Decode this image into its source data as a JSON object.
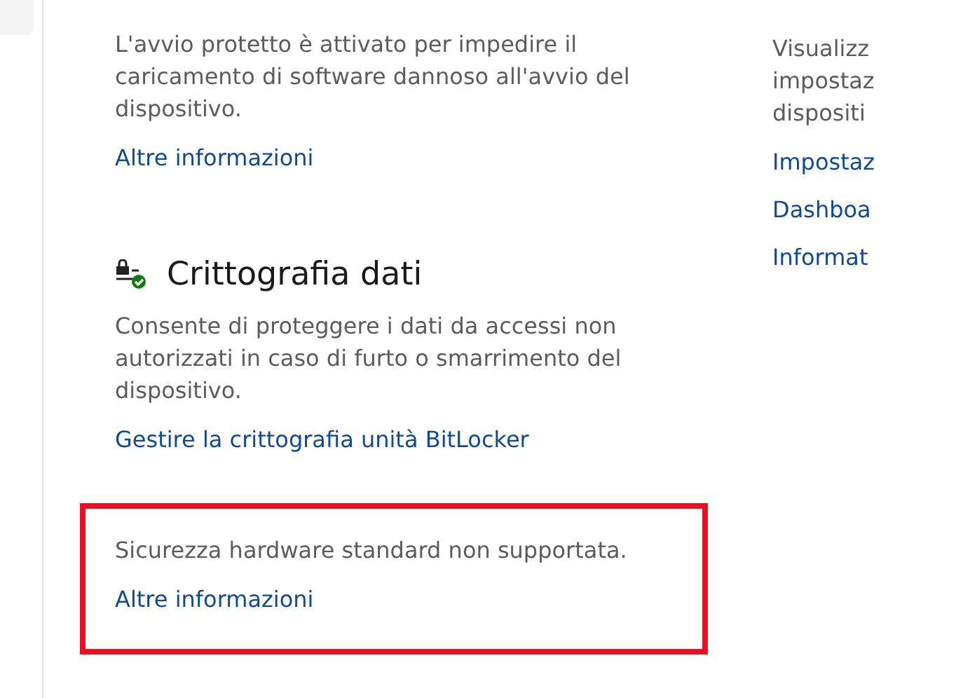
{
  "sections": [
    {
      "kind": "plain",
      "description": "L'avvio protetto è attivato per impedire il caricamento di software dannoso all'avvio del dispositivo.",
      "links": [
        "Altre informazioni"
      ]
    },
    {
      "kind": "titled",
      "title": "Crittografia dati",
      "description": "Consente di proteggere i dati da accessi non autorizzati in caso di furto o smarrimento del dispositivo.",
      "links": [
        "Gestire la crittografia unità BitLocker"
      ]
    },
    {
      "kind": "highlighted",
      "description": "Sicurezza hardware standard non supportata.",
      "links": [
        "Altre informazioni"
      ]
    }
  ],
  "side_panel": {
    "description_lines": [
      "Visualizz",
      "impostaz",
      "dispositi"
    ],
    "links": [
      "Impostaz",
      "Dashboa",
      "Informat"
    ]
  }
}
